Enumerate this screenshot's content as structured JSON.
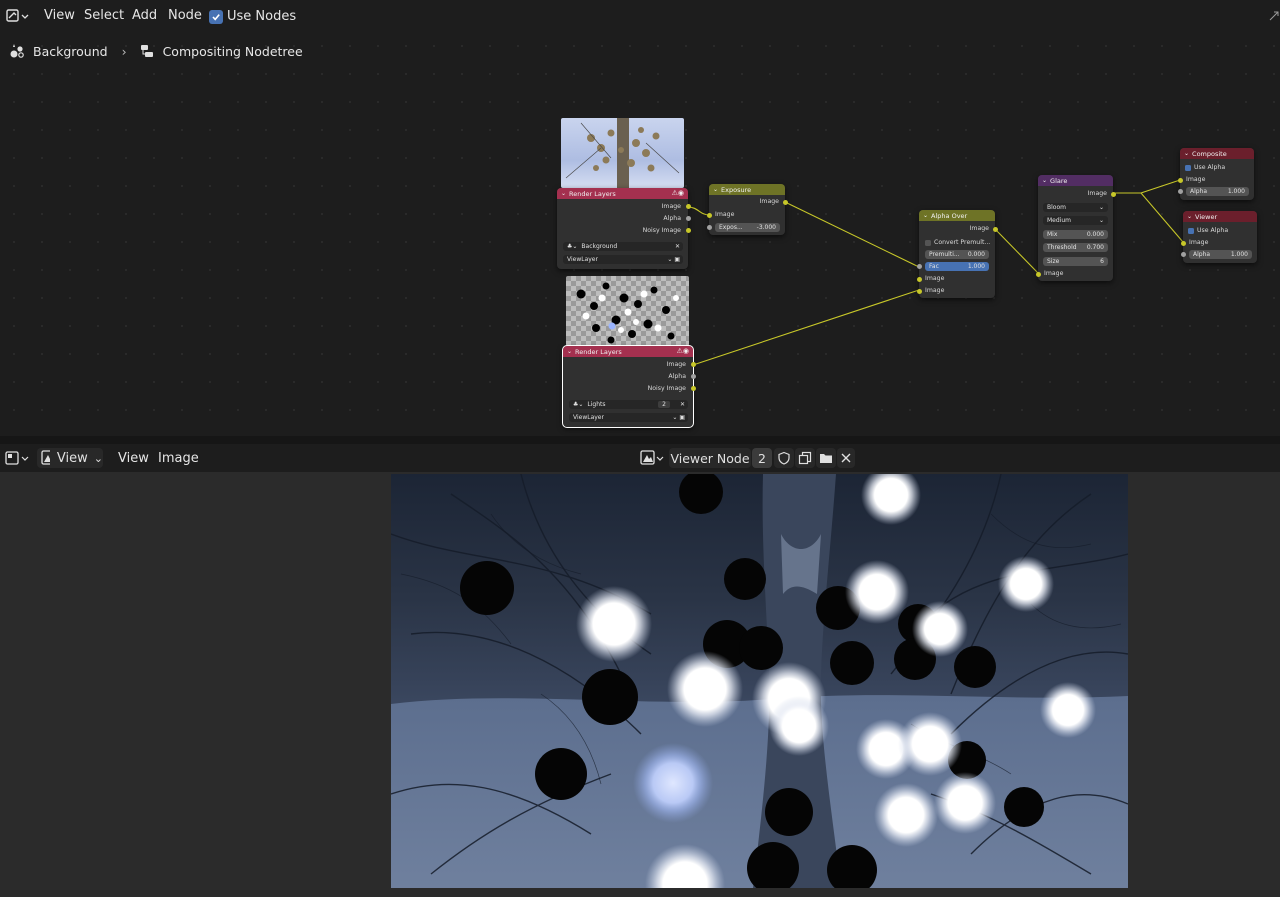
{
  "top_menu": {
    "view": "View",
    "select": "Select",
    "add": "Add",
    "node": "Node",
    "use_nodes": "Use Nodes"
  },
  "breadcrumb": {
    "scene": "Background",
    "tree": "Compositing Nodetree"
  },
  "nodes": {
    "render_layers_1": {
      "title": "Render Layers",
      "outputs": [
        "Image",
        "Alpha",
        "Noisy Image"
      ],
      "scene": "Background",
      "layer": "ViewLayer"
    },
    "render_layers_2": {
      "title": "Render Layers",
      "outputs": [
        "Image",
        "Alpha",
        "Noisy Image"
      ],
      "scene": "Lights",
      "scene_users": "2",
      "layer": "ViewLayer"
    },
    "exposure": {
      "title": "Exposure",
      "output": "Image",
      "input": "Image",
      "field_label": "Expos...",
      "field_value": "-3.000"
    },
    "alpha_over": {
      "title": "Alpha Over",
      "output": "Image",
      "convert_label": "Convert Premult...",
      "premul_label": "Premulti...",
      "premul_value": "0.000",
      "fac_label": "Fac",
      "fac_value": "1.000",
      "input_1": "Image",
      "input_2": "Image"
    },
    "glare": {
      "title": "Glare",
      "output": "Image",
      "type": "Bloom",
      "quality": "Medium",
      "mix_label": "Mix",
      "mix_value": "0.000",
      "threshold_label": "Threshold",
      "threshold_value": "0.700",
      "size_label": "Size",
      "size_value": "6",
      "input": "Image"
    },
    "composite": {
      "title": "Composite",
      "use_alpha": "Use Alpha",
      "input": "Image",
      "alpha_label": "Alpha",
      "alpha_value": "1.000"
    },
    "viewer": {
      "title": "Viewer",
      "use_alpha": "Use Alpha",
      "input": "Image",
      "alpha_label": "Alpha",
      "alpha_value": "1.000"
    }
  },
  "image_editor": {
    "view_mode": "View",
    "menu_view": "View",
    "menu_image": "Image",
    "image_name": "Viewer Node",
    "user_count": "2"
  },
  "colors": {
    "accent": "#4772b3",
    "input_node_header": "#a4304f",
    "color_node_header": "#6e7326",
    "filter_node_header": "#522d63",
    "output_node_header": "#6b1f2c",
    "link": "#c7c729"
  }
}
